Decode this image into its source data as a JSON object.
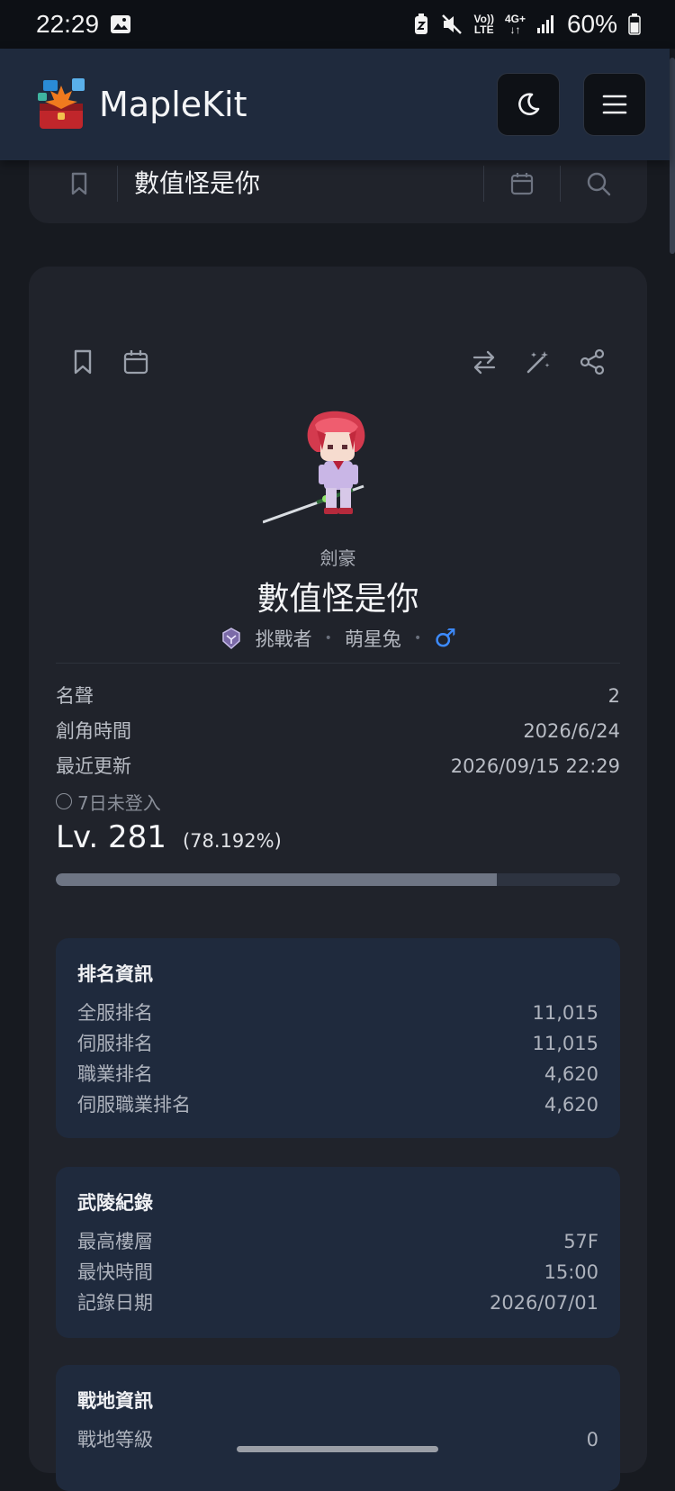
{
  "status_bar": {
    "time": "22:29",
    "battery": "60%",
    "volte_top": "Vo))",
    "volte_bottom": "LTE",
    "network": "4G+"
  },
  "header": {
    "app_title": "MapleKit"
  },
  "search": {
    "query": "數值怪是你"
  },
  "character": {
    "job": "劍豪",
    "name": "數值怪是你",
    "server": "挑戰者",
    "guild": "萌星兔",
    "gender_symbol": "♂",
    "info": [
      {
        "label": "名聲",
        "value": "2"
      },
      {
        "label": "創角時間",
        "value": "2026/6/24"
      },
      {
        "label": "最近更新",
        "value": "2026/09/15 22:29"
      }
    ],
    "offline_text": "7日未登入",
    "level": "Lv. 281",
    "exp_percent_text": "(78.192%)",
    "exp_fraction": 0.78192
  },
  "ranking": {
    "title": "排名資訊",
    "rows": [
      {
        "label": "全服排名",
        "value": "11,015"
      },
      {
        "label": "伺服排名",
        "value": "11,015"
      },
      {
        "label": "職業排名",
        "value": "4,620"
      },
      {
        "label": "伺服職業排名",
        "value": "4,620"
      }
    ]
  },
  "dojo": {
    "title": "武陵紀錄",
    "rows": [
      {
        "label": "最高樓層",
        "value": "57F"
      },
      {
        "label": "最快時間",
        "value": "15:00"
      },
      {
        "label": "記錄日期",
        "value": "2026/07/01"
      }
    ]
  },
  "union": {
    "title": "戰地資訊",
    "rows": [
      {
        "label": "戰地等級",
        "value": "0"
      }
    ]
  },
  "colors": {
    "background": "#171a20",
    "card": "#20232b",
    "section": "#1f2a3d",
    "gender_blue": "#3d8bff"
  }
}
